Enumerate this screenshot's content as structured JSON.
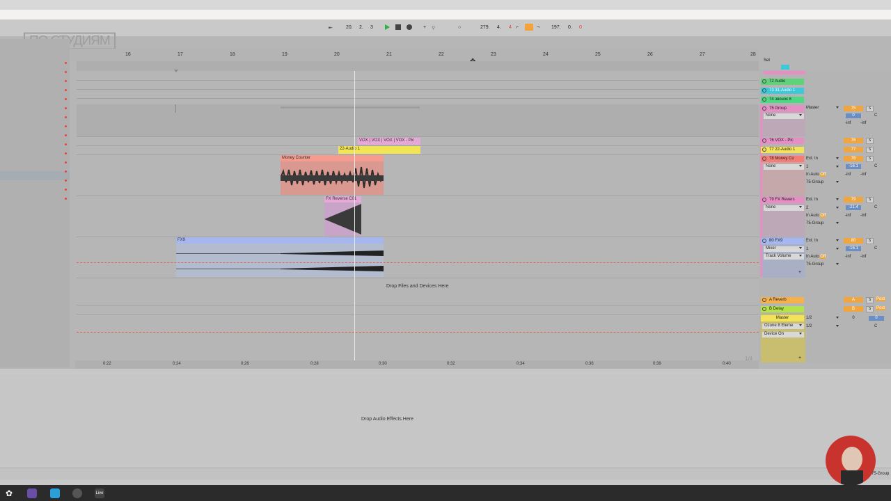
{
  "transport": {
    "position": [
      "20.",
      "2.",
      "3"
    ],
    "tempo_left": "279.",
    "tempo_mid": "4.",
    "tempo_right": "4",
    "loop_len": [
      "197.",
      "0.",
      "0"
    ]
  },
  "logo": "ПО СТУДИЯМ",
  "ruler_bars": [
    "16",
    "17",
    "18",
    "19",
    "20",
    "21",
    "22",
    "23",
    "24",
    "25",
    "26",
    "27",
    "28"
  ],
  "set_label": "Set",
  "clips": {
    "vox": "VOX | VOX | VOX | VOX - Pic",
    "audio22": "22-Audio 1",
    "money": "Money Counter",
    "fxrev": "FX Reverse C01",
    "fx9": "FX9"
  },
  "drop_files": "Drop Files and Devices Here",
  "drop_effects": "Drop Audio Effects Here",
  "time_ruler": [
    "0:22",
    "0:24",
    "0:26",
    "0:28",
    "0:30",
    "0:32",
    "0:34",
    "0:36",
    "0:38",
    "0:40"
  ],
  "page_indicator": "1/4",
  "tracks": [
    {
      "name": "72 Audio",
      "num": "72",
      "color": "#5fd27a"
    },
    {
      "name": "73 31-Audio 1",
      "num": "73",
      "color": "#3dc9d8"
    },
    {
      "name": "74 звонок 8",
      "num": "74",
      "color": "#4fd883"
    },
    {
      "name": "75 Group",
      "num": "75",
      "color": "#e58fc4"
    },
    {
      "name": "76 VOX - Pic",
      "num": "76",
      "color": "#e58fc4"
    },
    {
      "name": "77 22-Audio 1",
      "num": "77",
      "color": "#f3e35a"
    },
    {
      "name": "78 Money Co",
      "num": "78",
      "color": "#f47e76"
    },
    {
      "name": "79 FX Revers",
      "num": "79",
      "color": "#e58fc4"
    },
    {
      "name": "80 FX9",
      "num": "80",
      "color": "#a6b6ee"
    }
  ],
  "returns": [
    {
      "name": "A Reverb",
      "letter": "A",
      "color": "#f6b14a"
    },
    {
      "name": "B Delay",
      "letter": "B",
      "color": "#b4e34a"
    },
    {
      "name": "Master",
      "letter": "",
      "color": "#f3e35a"
    }
  ],
  "io": {
    "master": "Master",
    "none": "None",
    "extin": "Ext. In",
    "ch1": "1",
    "ch2": "2",
    "in": "In",
    "auto": "Auto",
    "off": "Off",
    "group75": "75-Group",
    "mixer": "Mixer",
    "trackvol": "Track Volume",
    "half": "1/2",
    "ozone": "Ozone 8 Eleme",
    "deviceon": "Device On"
  },
  "values": {
    "zero": "0",
    "c": "C",
    "inf": "-inf",
    "v78": "-16.1",
    "v79": "-21.4",
    "v80": "-16.1",
    "s": "S",
    "post": "Post"
  },
  "statusbar_right": "75-Group",
  "taskbar_live": "Live"
}
